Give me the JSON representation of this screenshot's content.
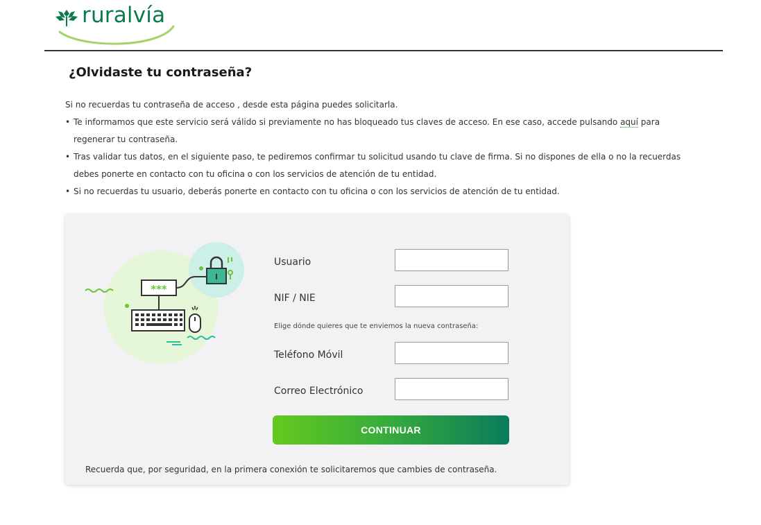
{
  "brand": {
    "name": "ruralvía",
    "color": "#0a7a4c",
    "accent": "#8cc63f"
  },
  "page": {
    "title": "¿Olvidaste tu contraseña?",
    "intro": "Si no recuerdas tu contraseña de acceso , desde esta página puedes solicitarla.",
    "bullets": {
      "b1_before": "Te informamos que este servicio será válido si previamente no has bloqueado tus claves de acceso. En ese caso, accede pulsando ",
      "b1_link": "aquí",
      "b1_after": " para regenerar tu contraseña.",
      "b2": "Tras validar tus datos, en el siguiente paso, te pediremos confirmar tu solicitud usando tu clave de firma. Si no dispones de ella o no la recuerdas debes ponerte en contacto con tu oficina o con los servicios de atención de tu entidad.",
      "b3": "Si no recuerdas tu usuario, deberás ponerte en contacto con tu oficina o con los servicios de atención de tu entidad."
    }
  },
  "form": {
    "usuario": {
      "label": "Usuario",
      "value": ""
    },
    "nif": {
      "label": "NIF / NIE",
      "value": ""
    },
    "hint": "Elige dónde quieres que te enviemos la nueva contraseña:",
    "telefono": {
      "label": "Teléfono Móvil",
      "value": ""
    },
    "correo": {
      "label": "Correo Electrónico",
      "value": ""
    },
    "submit_label": "CONTINUAR",
    "footnote": "Recuerda que, por seguridad, en la primera conexión te solicitaremos que cambies de contraseña.",
    "illustration_password": "***"
  },
  "icons": {
    "logo": "wheat-emblem-icon",
    "illustration": "password-keyboard-lock-icon"
  }
}
